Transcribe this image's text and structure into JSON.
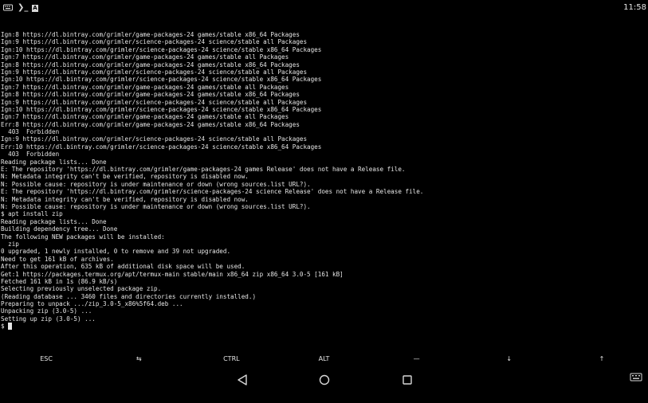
{
  "status_bar": {
    "clock": "11:58",
    "icons": [
      "keyboard-icon",
      "terminal-prompt-icon",
      "notification-icon"
    ],
    "prompt_glyph": "❯_",
    "notify_glyph": "A"
  },
  "terminal": {
    "lines": [
      "Ign:8 https://dl.bintray.com/grimler/game-packages-24 games/stable x86_64 Packages",
      "Ign:9 https://dl.bintray.com/grimler/science-packages-24 science/stable all Packages",
      "Ign:10 https://dl.bintray.com/grimler/science-packages-24 science/stable x86_64 Packages",
      "Ign:7 https://dl.bintray.com/grimler/game-packages-24 games/stable all Packages",
      "Ign:8 https://dl.bintray.com/grimler/game-packages-24 games/stable x86_64 Packages",
      "Ign:9 https://dl.bintray.com/grimler/science-packages-24 science/stable all Packages",
      "Ign:10 https://dl.bintray.com/grimler/science-packages-24 science/stable x86_64 Packages",
      "Ign:7 https://dl.bintray.com/grimler/game-packages-24 games/stable all Packages",
      "Ign:8 https://dl.bintray.com/grimler/game-packages-24 games/stable x86_64 Packages",
      "Ign:9 https://dl.bintray.com/grimler/science-packages-24 science/stable all Packages",
      "Ign:10 https://dl.bintray.com/grimler/science-packages-24 science/stable x86_64 Packages",
      "Ign:7 https://dl.bintray.com/grimler/game-packages-24 games/stable all Packages",
      "Err:8 https://dl.bintray.com/grimler/game-packages-24 games/stable x86_64 Packages",
      "  403  Forbidden",
      "Ign:9 https://dl.bintray.com/grimler/science-packages-24 science/stable all Packages",
      "Err:10 https://dl.bintray.com/grimler/science-packages-24 science/stable x86_64 Packages",
      "  403  Forbidden",
      "Reading package lists... Done",
      "E: The repository 'https://dl.bintray.com/grimler/game-packages-24 games Release' does not have a Release file.",
      "N: Metadata integrity can't be verified, repository is disabled now.",
      "N: Possible cause: repository is under maintenance or down (wrong sources.list URL?).",
      "E: The repository 'https://dl.bintray.com/grimler/science-packages-24 science Release' does not have a Release file.",
      "N: Metadata integrity can't be verified, repository is disabled now.",
      "N: Possible cause: repository is under maintenance or down (wrong sources.list URL?).",
      "$ apt install zip",
      "Reading package lists... Done",
      "Building dependency tree... Done",
      "The following NEW packages will be installed:",
      "  zip",
      "0 upgraded, 1 newly installed, 0 to remove and 39 not upgraded.",
      "Need to get 161 kB of archives.",
      "After this operation, 635 kB of additional disk space will be used.",
      "Get:1 https://packages.termux.org/apt/termux-main stable/main x86_64 zip x86_64 3.0-5 [161 kB]",
      "Fetched 161 kB in 1s (86.9 kB/s)",
      "Selecting previously unselected package zip.",
      "(Reading database ... 3460 files and directories currently installed.)",
      "Preparing to unpack .../zip_3.0-5_x86%5f64.deb ...",
      "Unpacking zip (3.0-5) ...",
      "Setting up zip (3.0-5) ..."
    ],
    "prompt": "$ "
  },
  "extra_keys": {
    "esc": "ESC",
    "tab": "⇆",
    "ctrl": "CTRL",
    "alt": "ALT",
    "dash": "—",
    "down": "↓",
    "up": "↑"
  },
  "nav_bar": {
    "icons": [
      "back-icon",
      "home-icon",
      "recents-icon",
      "keyboard-icon"
    ]
  },
  "colors": {
    "background": "#000000",
    "foreground": "#e6e6e6"
  }
}
